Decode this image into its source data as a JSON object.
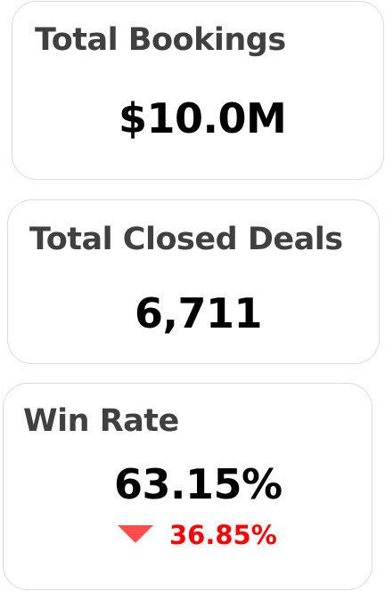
{
  "cards": {
    "bookings": {
      "title": "Total Bookings",
      "value": "$10.0M"
    },
    "closed_deals": {
      "title": "Total Closed Deals",
      "value": "6,711"
    },
    "win_rate": {
      "title": "Win Rate",
      "value": "63.15%",
      "delta": {
        "icon": "triangle-down-icon",
        "value": "36.85%",
        "direction": "down"
      }
    }
  },
  "colors": {
    "title_text": "#404040",
    "value_text": "#000000",
    "negative": "#ff0000",
    "negative_icon": "#ff4d4d",
    "card_border": "#d9d9d9"
  }
}
